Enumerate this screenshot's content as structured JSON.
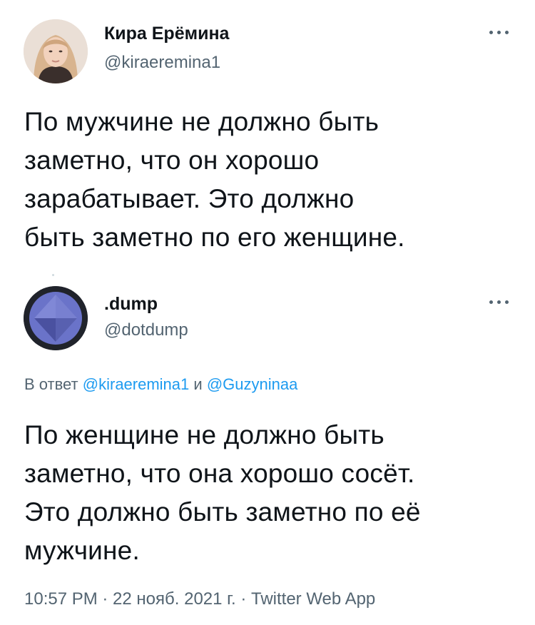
{
  "tweet1": {
    "name": "Кира Ерёмина",
    "handle": "@kiraeremina1",
    "more_icon": "more-horizontal-icon",
    "lines": [
      "По мужчине не должно быть",
      "заметно, что он хорошо",
      "зарабатывает. Это должно",
      "быть заметно по его женщине."
    ]
  },
  "tweet2": {
    "name": ".dump",
    "handle": "@dotdump",
    "more_icon": "more-horizontal-icon",
    "reply_prefix": "В ответ",
    "reply_user1": "@kiraeremina1",
    "reply_and": "и",
    "reply_user2": "@Guzyninaa",
    "lines": [
      "По женщине не должно быть",
      "заметно, что она хорошо сосёт.",
      "Это должно быть заметно по её",
      "мужчине."
    ],
    "meta": "10:57 PM · 22 нояб. 2021 г. · Twitter Web App"
  },
  "colors": {
    "text": "#0f1419",
    "secondary": "#536471",
    "link": "#1d9bf0",
    "background": "#ffffff"
  }
}
